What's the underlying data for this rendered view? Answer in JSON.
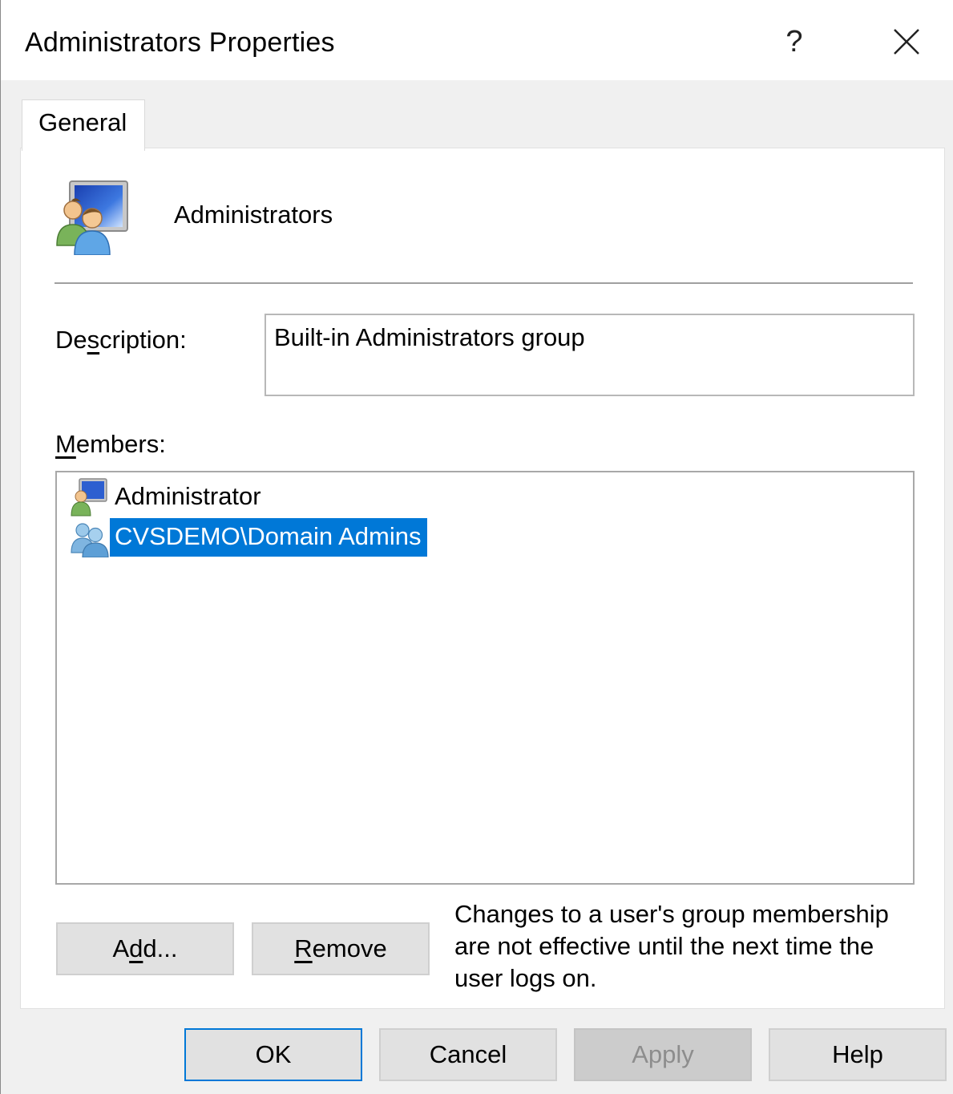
{
  "window": {
    "title": "Administrators Properties",
    "help_glyph": "?"
  },
  "tabs": [
    {
      "label": "General",
      "active": true
    }
  ],
  "group": {
    "name": "Administrators",
    "icon": "group-icon"
  },
  "description": {
    "label_before": "De",
    "label_access": "s",
    "label_after": "cription:",
    "value": "Built-in Administrators group"
  },
  "members": {
    "label_access": "M",
    "label_after": "embers:",
    "items": [
      {
        "name": "Administrator",
        "icon": "user-icon",
        "selected": false
      },
      {
        "name": "CVSDEMO\\Domain Admins",
        "icon": "group-icon",
        "selected": true
      }
    ],
    "selection_color": "#0078d7"
  },
  "member_buttons": {
    "add": {
      "before": "A",
      "access": "d",
      "after": "d..."
    },
    "remove": {
      "access": "R",
      "after": "emove"
    }
  },
  "note": "Changes to a user's group membership are not effective until the next time the user logs on.",
  "footer": {
    "ok": "OK",
    "cancel": "Cancel",
    "apply": "Apply",
    "help": "Help"
  }
}
